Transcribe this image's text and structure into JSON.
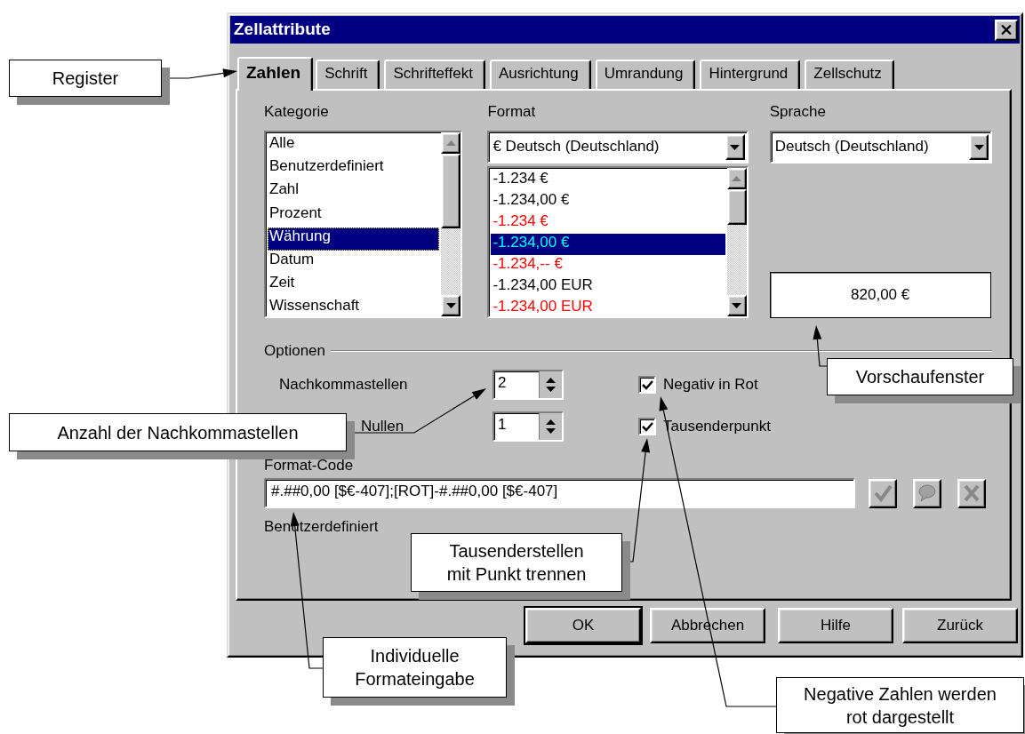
{
  "window": {
    "title": "Zellattribute"
  },
  "tabs": [
    {
      "label": "Zahlen",
      "selected": true
    },
    {
      "label": "Schrift",
      "selected": false
    },
    {
      "label": "Schrifteffekt",
      "selected": false
    },
    {
      "label": "Ausrichtung",
      "selected": false
    },
    {
      "label": "Umrandung",
      "selected": false
    },
    {
      "label": "Hintergrund",
      "selected": false
    },
    {
      "label": "Zellschutz",
      "selected": false
    }
  ],
  "kategorie": {
    "label": "Kategorie",
    "items": [
      {
        "label": "Alle",
        "selected": false
      },
      {
        "label": "Benutzerdefiniert",
        "selected": false
      },
      {
        "label": "Zahl",
        "selected": false
      },
      {
        "label": "Prozent",
        "selected": false
      },
      {
        "label": "Währung",
        "selected": true
      },
      {
        "label": "Datum",
        "selected": false
      },
      {
        "label": "Zeit",
        "selected": false
      },
      {
        "label": "Wissenschaft",
        "selected": false
      }
    ]
  },
  "format": {
    "label": "Format",
    "dropdown": "€ Deutsch (Deutschland)",
    "items": [
      {
        "label": "-1.234 €",
        "selected": false,
        "color": "#000000"
      },
      {
        "label": "-1.234,00 €",
        "selected": false,
        "color": "#000000"
      },
      {
        "label": "-1.234 €",
        "selected": false,
        "color": "#ff0000"
      },
      {
        "label": "-1.234,00 €",
        "selected": true,
        "color": "#00ffff"
      },
      {
        "label": "-1.234,-- €",
        "selected": false,
        "color": "#ff0000"
      },
      {
        "label": "-1.234,00 EUR",
        "selected": false,
        "color": "#000000"
      },
      {
        "label": "-1.234,00 EUR",
        "selected": false,
        "color": "#ff0000"
      }
    ]
  },
  "sprache": {
    "label": "Sprache",
    "dropdown": "Deutsch (Deutschland)"
  },
  "preview": "820,00 €",
  "optionen": {
    "label": "Optionen",
    "spinners": [
      {
        "label": "Nachkommastellen",
        "value": "2"
      },
      {
        "label": "Nullen",
        "value": "1"
      }
    ],
    "checkboxes": [
      {
        "label": "Negativ in Rot",
        "checked": true
      },
      {
        "label": "Tausenderpunkt",
        "checked": true
      }
    ]
  },
  "format_code": {
    "label": "Format-Code",
    "value": "#.##0,00 [$€-407];[ROT]-#.##0,00 [$€-407]",
    "description": "Benutzerdefiniert"
  },
  "buttons": [
    {
      "label": "OK",
      "default": true
    },
    {
      "label": "Abbrechen",
      "default": false
    },
    {
      "label": "Hilfe",
      "default": false
    },
    {
      "label": "Zurück",
      "default": false
    }
  ],
  "callouts": [
    {
      "text": "Register"
    },
    {
      "text": "Vorschaufenster"
    },
    {
      "text": "Anzahl der Nachkommastellen"
    },
    {
      "text": "Tausenderstellen\nmit Punkt trennen"
    },
    {
      "text": "Individuelle\nFormateingabe"
    },
    {
      "text": "Negative Zahlen werden\nrot dargestellt"
    }
  ]
}
